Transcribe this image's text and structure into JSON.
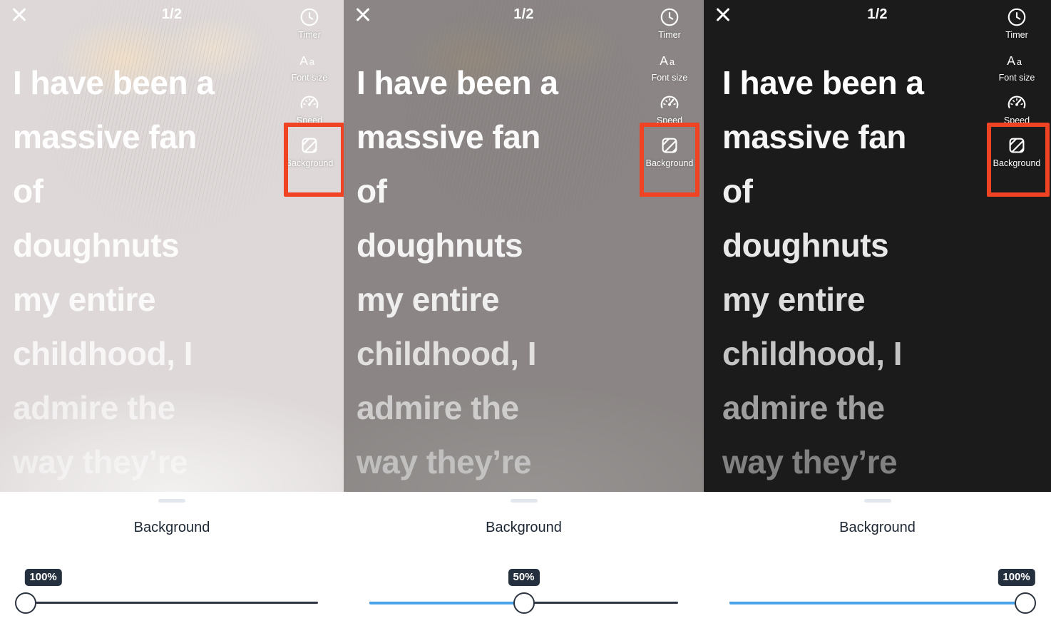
{
  "app": {
    "caption_lines": [
      "I have been a",
      "massive fan",
      "of",
      "doughnuts",
      "my entire",
      "childhood, I",
      "admire the",
      "way they’re"
    ],
    "page_counter": "1/2",
    "close_icon": "close-icon",
    "tools": [
      {
        "icon": "timer-icon",
        "label": "Timer"
      },
      {
        "icon": "font-size-icon",
        "label": "Font size"
      },
      {
        "icon": "speed-icon",
        "label": "Speed"
      },
      {
        "icon": "background-icon",
        "label": "Background"
      }
    ],
    "sheet_title": "Background",
    "grabber": "sheet-grabber"
  },
  "colors": {
    "highlight_red": "#f04323",
    "slider_fill_blue": "#4aa3e8",
    "slider_track_dark": "#2b3440",
    "badge_bg": "#24303d",
    "sheet_bg": "#ffffff",
    "dark_preview_bg": "#1b1b1b"
  },
  "panels": [
    {
      "id": "panel-1",
      "variant": "photo-full-opacity",
      "page_counter": "1/2",
      "sheet_title": "Background",
      "slider": {
        "value_label": "100%",
        "value": 100,
        "thumb_percent": 0,
        "fill_percent": 0,
        "filled": false
      }
    },
    {
      "id": "panel-2",
      "variant": "photo-dimmed",
      "page_counter": "1/2",
      "sheet_title": "Background",
      "slider": {
        "value_label": "50%",
        "value": 50,
        "thumb_percent": 50,
        "fill_percent": 50,
        "filled": true
      }
    },
    {
      "id": "panel-3",
      "variant": "solid-black",
      "page_counter": "1/2",
      "sheet_title": "Background",
      "slider": {
        "value_label": "100%",
        "value": 100,
        "thumb_percent": 100,
        "fill_percent": 100,
        "filled": true
      }
    }
  ]
}
